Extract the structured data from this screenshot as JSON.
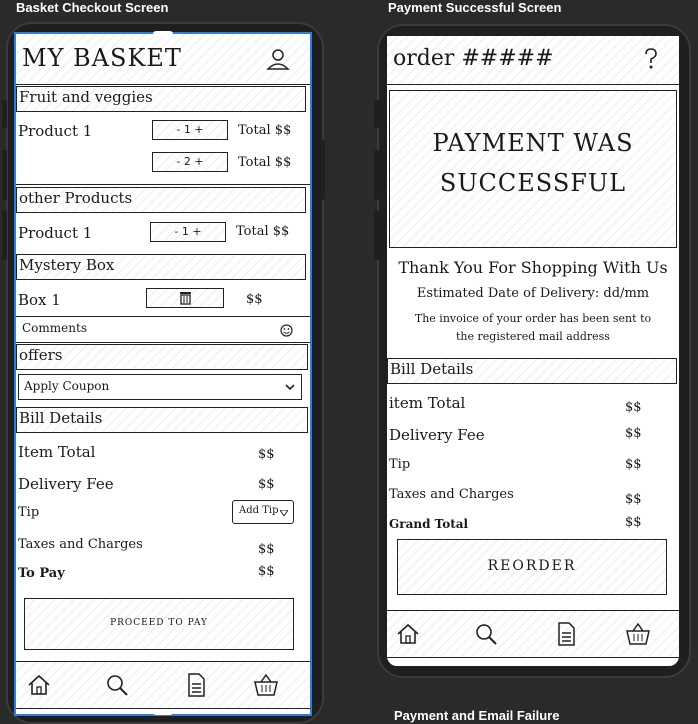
{
  "frames": {
    "basket_title": "Basket Checkout Screen",
    "payment_title": "Payment Successful Screen",
    "failure_title": "Payment and Email Failure"
  },
  "basket": {
    "header_title": "MY BASKET",
    "sections": {
      "fruit": "Fruit and veggies",
      "other": "other Products",
      "mystery": "Mystery Box",
      "offers": "offers",
      "bill": "Bill Details"
    },
    "products": [
      {
        "name": "Product 1",
        "stepper": "- 1 +",
        "total": "Total $$"
      },
      {
        "name": "",
        "stepper": "- 2 +",
        "total": "Total $$"
      }
    ],
    "other_products": [
      {
        "name": "Product 1",
        "stepper": "- 1 +",
        "total": "Total $$"
      }
    ],
    "mystery": {
      "name": "Box 1",
      "price": "$$"
    },
    "comments_placeholder": "Comments",
    "coupon_label": "Apply Coupon",
    "bill": {
      "item_total_label": "Item Total",
      "item_total_value": "$$",
      "delivery_label": "Delivery Fee",
      "delivery_value": "$$",
      "tip_label": "Tip",
      "tip_button": "Add Tip",
      "taxes_label": "Taxes and Charges",
      "taxes_value": "$$",
      "topay_label": "To Pay",
      "topay_value": "$$"
    },
    "proceed_label": "PROCEED TO PAY"
  },
  "payment": {
    "header_title": "order #####",
    "help_icon": "question-icon",
    "banner_line1": "PAYMENT WAS",
    "banner_line2": "SUCCESSFUL",
    "thanks": "Thank You For Shopping With Us",
    "delivery_date": "Estimated Date of Delivery: dd/mm",
    "invoice_line1": "The invoice of your order has been sent to",
    "invoice_line2": "the registered mail address",
    "bill_header": "Bill Details",
    "bill": {
      "item_total_label": "item Total",
      "item_total_value": "$$",
      "delivery_label": "Delivery Fee",
      "delivery_value": "$$",
      "tip_label": "Tip",
      "tip_value": "$$",
      "taxes_label": "Taxes and Charges",
      "taxes_value": "$$",
      "grand_label": "Grand Total",
      "grand_value": "$$"
    },
    "reorder_label": "REORDER"
  },
  "nav_icons": [
    "home-icon",
    "search-icon",
    "document-icon",
    "basket-icon"
  ],
  "colors": {
    "selection": "#2f7de1",
    "canvas": "#2a2a2a"
  }
}
